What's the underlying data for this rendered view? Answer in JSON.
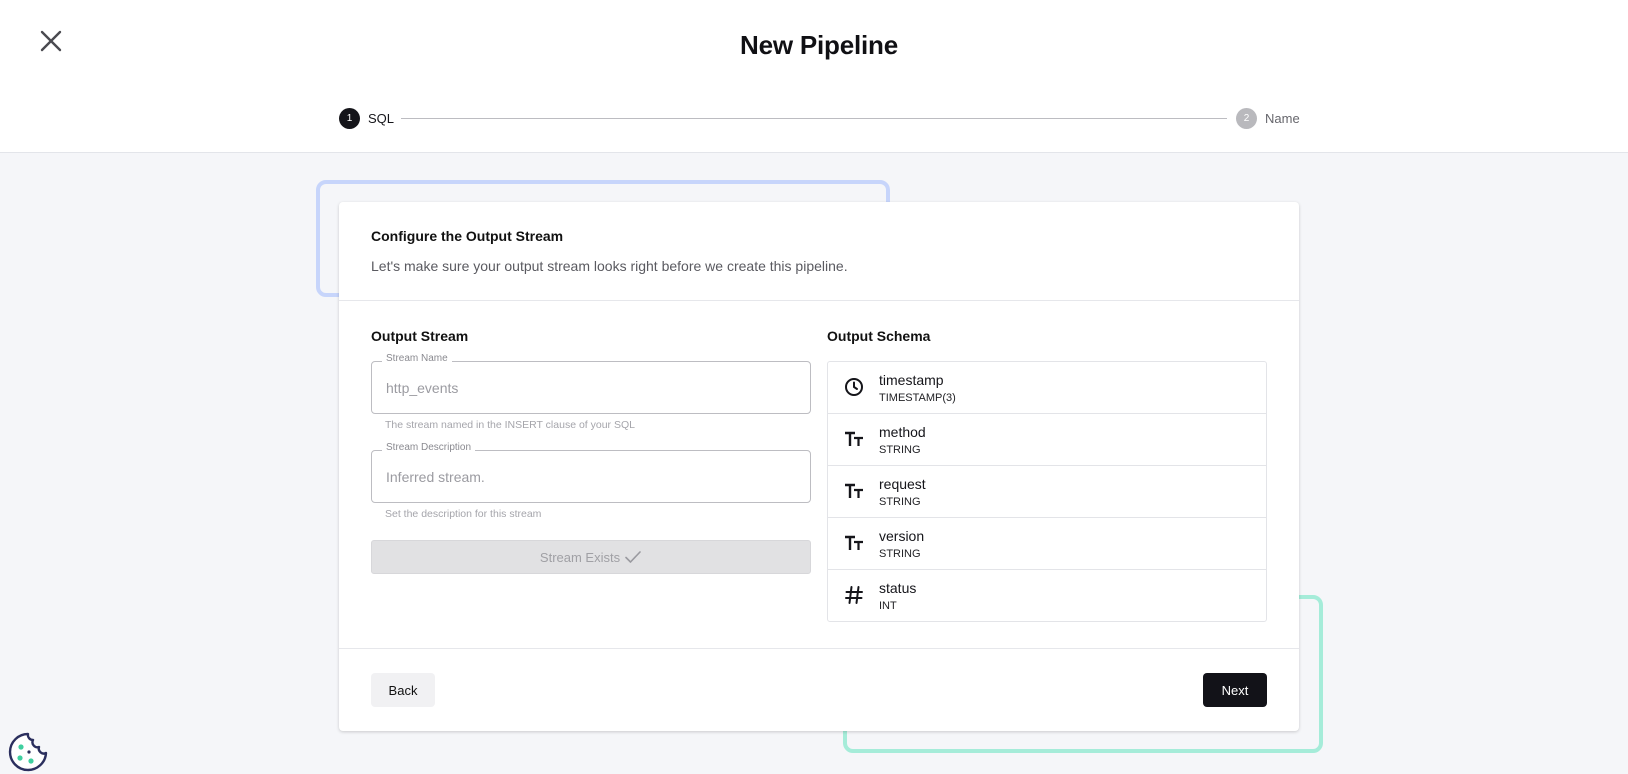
{
  "header": {
    "title": "New Pipeline",
    "close_icon": "close-icon"
  },
  "stepper": {
    "steps": [
      {
        "number": "1",
        "label": "SQL",
        "state": "active"
      },
      {
        "number": "2",
        "label": "Name",
        "state": "inactive"
      }
    ]
  },
  "card": {
    "title": "Configure the Output Stream",
    "subtitle": "Let's make sure your output stream looks right before we create this pipeline."
  },
  "output_stream": {
    "section_title": "Output Stream",
    "name_field": {
      "label": "Stream Name",
      "value": "http_events",
      "helper": "The stream named in the INSERT clause of your SQL"
    },
    "description_field": {
      "label": "Stream Description",
      "value": "Inferred stream.",
      "helper": "Set the description for this stream"
    },
    "status_button": {
      "label": "Stream Exists",
      "icon": "checkmark-icon"
    }
  },
  "output_schema": {
    "section_title": "Output Schema",
    "fields": [
      {
        "name": "timestamp",
        "type": "TIMESTAMP(3)",
        "icon": "clock-icon"
      },
      {
        "name": "method",
        "type": "STRING",
        "icon": "text-type-icon"
      },
      {
        "name": "request",
        "type": "STRING",
        "icon": "text-type-icon"
      },
      {
        "name": "version",
        "type": "STRING",
        "icon": "text-type-icon"
      },
      {
        "name": "status",
        "type": "INT",
        "icon": "hash-icon"
      }
    ]
  },
  "footer": {
    "back_label": "Back",
    "next_label": "Next"
  },
  "colors": {
    "accent_dark": "#121218",
    "decor_blue": "#c7d5fb",
    "decor_green": "#a5ecd9",
    "background": "#f5f6f9"
  }
}
